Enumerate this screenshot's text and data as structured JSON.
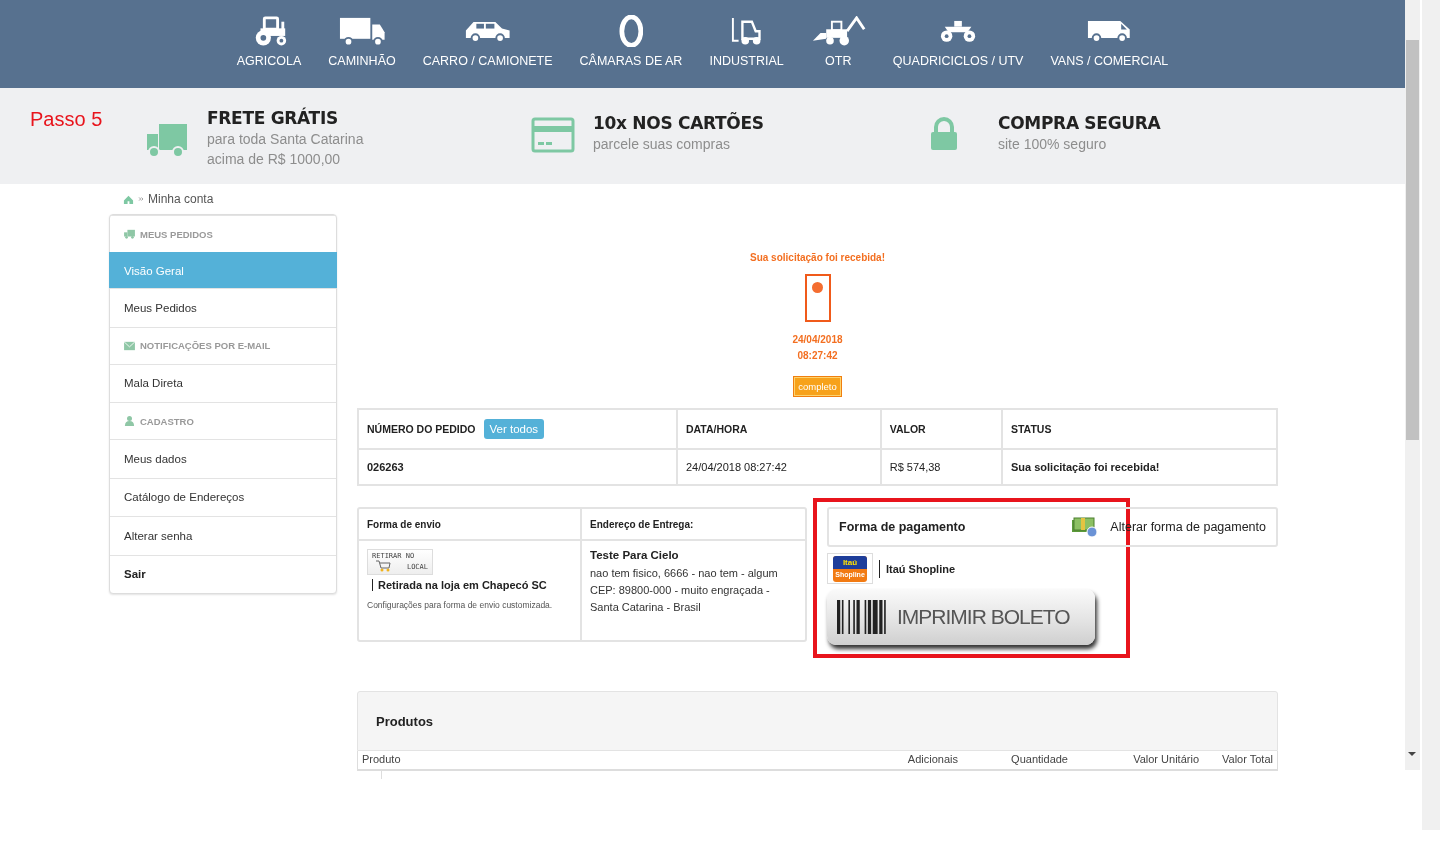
{
  "nav": [
    {
      "label": "AGRICOLA"
    },
    {
      "label": "CAMINHÃO"
    },
    {
      "label": "CARRO / CAMIONETE"
    },
    {
      "label": "CÂMARAS DE AR"
    },
    {
      "label": "INDUSTRIAL"
    },
    {
      "label": "OTR"
    },
    {
      "label": "QUADRICICLOS / UTV"
    },
    {
      "label": "VANS / COMERCIAL"
    }
  ],
  "annotation": {
    "step": "Passo 5"
  },
  "features": [
    {
      "title": "FRETE GRÁTIS",
      "lines": [
        "para toda Santa Catarina",
        "acima de R$ 1000,00"
      ]
    },
    {
      "title": "10x NOS CARTÕES",
      "lines": [
        "parcele suas compras"
      ]
    },
    {
      "title": "COMPRA SEGURA",
      "lines": [
        "site 100% seguro"
      ]
    }
  ],
  "breadcrumb": {
    "current": "Minha conta"
  },
  "sidebar": {
    "items": [
      {
        "kind": "header",
        "label": "MEUS PEDIDOS",
        "selected": false
      },
      {
        "kind": "link",
        "label": "Visão Geral",
        "selected": true
      },
      {
        "kind": "link",
        "label": "Meus Pedidos",
        "selected": false
      },
      {
        "kind": "header",
        "label": "NOTIFICAÇÕES POR E-MAIL",
        "selected": false
      },
      {
        "kind": "link",
        "label": "Mala Direta",
        "selected": false
      },
      {
        "kind": "header",
        "label": "CADASTRO",
        "selected": false
      },
      {
        "kind": "link",
        "label": "Meus dados",
        "selected": false
      },
      {
        "kind": "link",
        "label": "Catálogo de Endereços",
        "selected": false
      },
      {
        "kind": "link",
        "label": "Alterar senha",
        "selected": false
      },
      {
        "kind": "exit",
        "label": "Sair",
        "selected": false
      }
    ]
  },
  "status": {
    "message": "Sua solicitação foi recebida!",
    "date": "24/04/2018",
    "time": "08:27:42",
    "badge": "completo"
  },
  "order_table": {
    "columns": [
      "NÚMERO DO PEDIDO",
      "DATA/HORA",
      "VALOR",
      "STATUS"
    ],
    "view_all": "Ver todos",
    "rows": [
      [
        "026263",
        "24/04/2018 08:27:42",
        "R$ 574,38",
        "Sua solicitação foi recebida!"
      ]
    ]
  },
  "shipping": {
    "heading": "Forma de envio",
    "logo_lines": [
      "RETIRAR NO",
      "LOCAL"
    ],
    "method": "Retirada na loja em Chapecó SC",
    "note": "Configurações para forma de envio customizada."
  },
  "address": {
    "heading": "Endereço de Entrega:",
    "name": "Teste Para Cielo",
    "lines": [
      "nao tem fisico, 6666 - nao tem - algum",
      "CEP: 89800-000 - muito engraçada -",
      "Santa Catarina - Brasil"
    ]
  },
  "payment": {
    "heading": "Forma de pagamento",
    "change_link": "Alterar forma de pagamento",
    "logo_lines": [
      "Itaú",
      "Shopline"
    ],
    "method": "Itaú Shopline",
    "print_button": "IMPRIMIR BOLETO"
  },
  "products": {
    "heading": "Produtos",
    "columns": [
      "Produto",
      "Adicionais",
      "Quantidade",
      "Valor Unitário",
      "Valor Total"
    ]
  }
}
